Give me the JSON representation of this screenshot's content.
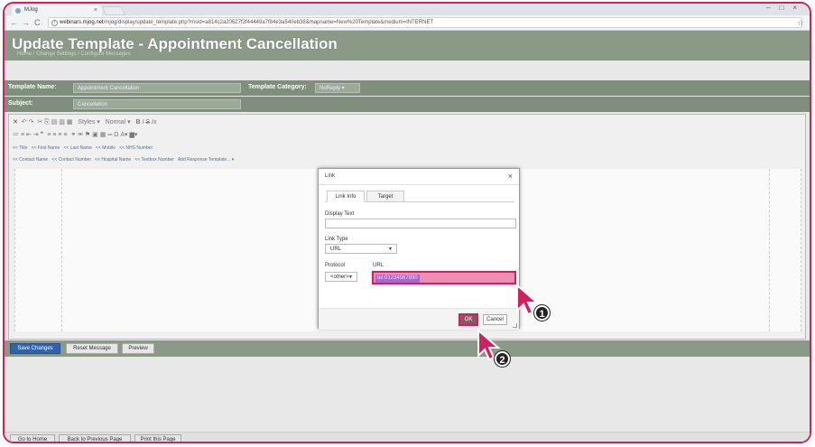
{
  "browser": {
    "tab_title": "MJog",
    "url_host": "webinars.mjog.net",
    "url_path": "/mjog/display/update_template.php?msid=a814c2a20627f2f44449a7f84e3a540eb38&mapname=New%20Template&medium=INTERNET"
  },
  "page": {
    "title": "Update Template - Appointment Cancellation",
    "breadcrumbs": [
      "Home",
      "Change Settings",
      "Configure Messages"
    ],
    "template_name_label": "Template Name:",
    "template_name_value": "Appointment Cancellation",
    "template_category_label": "Template Category:",
    "template_category_value": "NoReply",
    "subject_label": "Subject:",
    "subject_value": "Cancellation"
  },
  "editor": {
    "toolbar_styles": "Styles",
    "toolbar_format": "Normal",
    "insert_fields_row1": [
      "<< Title",
      "<< First Name",
      "<< Last Name",
      "<< Mobile",
      "<< NHS Number"
    ],
    "insert_fields_row2": [
      "<< Contact Name",
      "<< Contact Number",
      "<< Hospital Name",
      "<< Textbox Number"
    ],
    "add_response_template": "Add Response Template..."
  },
  "actions": {
    "save": "Save Changes",
    "reset": "Reset Message",
    "preview": "Preview"
  },
  "footer": {
    "home": "Go to Home",
    "back": "Back to Previous Page",
    "print": "Print this Page"
  },
  "dialog": {
    "title": "Link",
    "close": "×",
    "tab_info": "Link Info",
    "tab_target": "Target",
    "display_text_label": "Display Text",
    "display_text_value": "",
    "link_type_label": "Link Type",
    "link_type_value": "URL",
    "protocol_label": "Protocol",
    "protocol_value": "<other>",
    "url_label": "URL",
    "url_value": "tel:01234567890",
    "ok": "OK",
    "cancel": "Cancel"
  },
  "annotations": {
    "step1": "1",
    "step2": "2"
  },
  "colors": {
    "accent": "#d21f5f",
    "header": "#8a9a87",
    "primary_button": "#2f63b0"
  }
}
